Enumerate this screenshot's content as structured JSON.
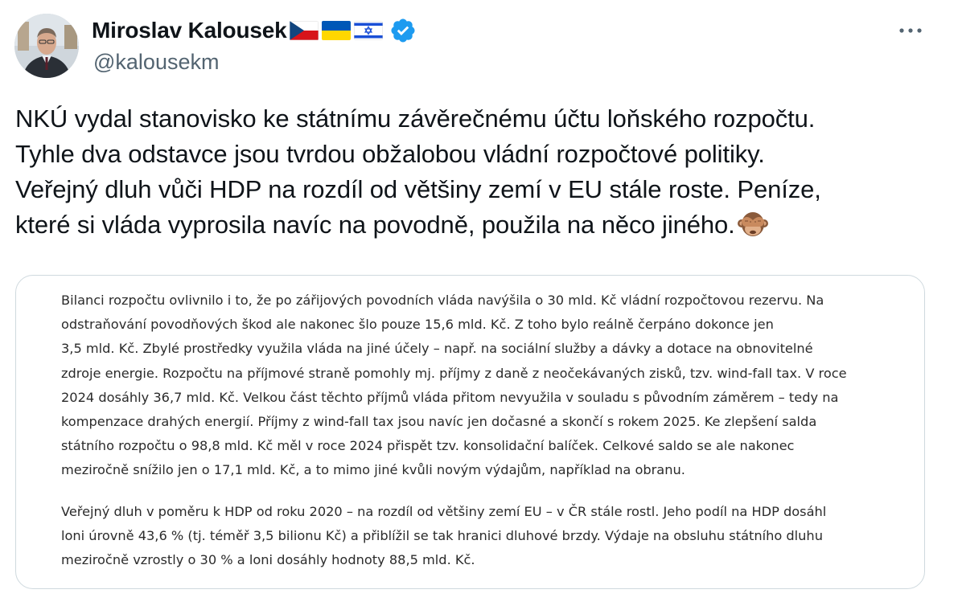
{
  "author": {
    "display_name": "Miroslav Kalousek",
    "handle": "@kalousekm",
    "flags": [
      "czech-flag-icon",
      "ukraine-flag-icon",
      "israel-flag-icon"
    ],
    "verified": true,
    "accent_color": "#1d9bf0"
  },
  "tweet": {
    "lines": [
      "NKÚ vydal stanovisko ke státnímu závěrečnému účtu loňského rozpočtu.",
      "Tyhle dva odstavce jsou tvrdou obžalobou vládní rozpočtové politiky.",
      "Veřejný dluh vůči HDP na rozdíl od většiny zemí v EU stále roste. Peníze,",
      "které si vláda vyprosila navíc na povodně, použila na něco jiného."
    ],
    "trailing_emoji": "see-no-evil-monkey-icon"
  },
  "quote_image": {
    "paragraph1": [
      "Bilanci rozpočtu ovlivnilo i to, že po zářijových povodních vláda navýšila o 30 mld. Kč vládní rozpočtovou rezervu. Na",
      "odstraňování povodňových škod ale nakonec šlo pouze 15,6 mld. Kč. Z toho bylo reálně čerpáno dokonce jen",
      "3,5 mld. Kč. Zbylé prostředky využila vláda na jiné účely – např. na sociální služby a dávky a dotace na obnovitelné",
      "zdroje energie. Rozpočtu na příjmové straně pomohly mj. příjmy z daně z neočekávaných zisků, tzv. wind-fall tax. V roce",
      "2024 dosáhly 36,7 mld. Kč. Velkou část těchto příjmů vláda přitom nevyužila v souladu s původním záměrem – tedy na",
      "kompenzace drahých energií. Příjmy z wind-fall tax jsou navíc jen dočasné a skončí s rokem 2025. Ke zlepšení salda",
      "státního rozpočtu o 98,8 mld. Kč měl v roce 2024 přispět tzv. konsolidační balíček. Celkové saldo se ale nakonec",
      "meziročně snížilo jen o 17,1 mld. Kč, a to mimo jiné kvůli novým výdajům, například na obranu."
    ],
    "paragraph2": [
      "Veřejný dluh v poměru k HDP od roku 2020 – na rozdíl od většiny zemí EU – v ČR stále rostl. Jeho podíl na HDP dosáhl",
      "loni úrovně 43,6 % (tj. téměř 3,5 bilionu Kč) a přiblížil se tak hranici dluhové brzdy. Výdaje na obsluhu státního dluhu",
      "meziročně vzrostly o 30 % a loni dosáhly hodnoty 88,5 mld. Kč."
    ]
  }
}
